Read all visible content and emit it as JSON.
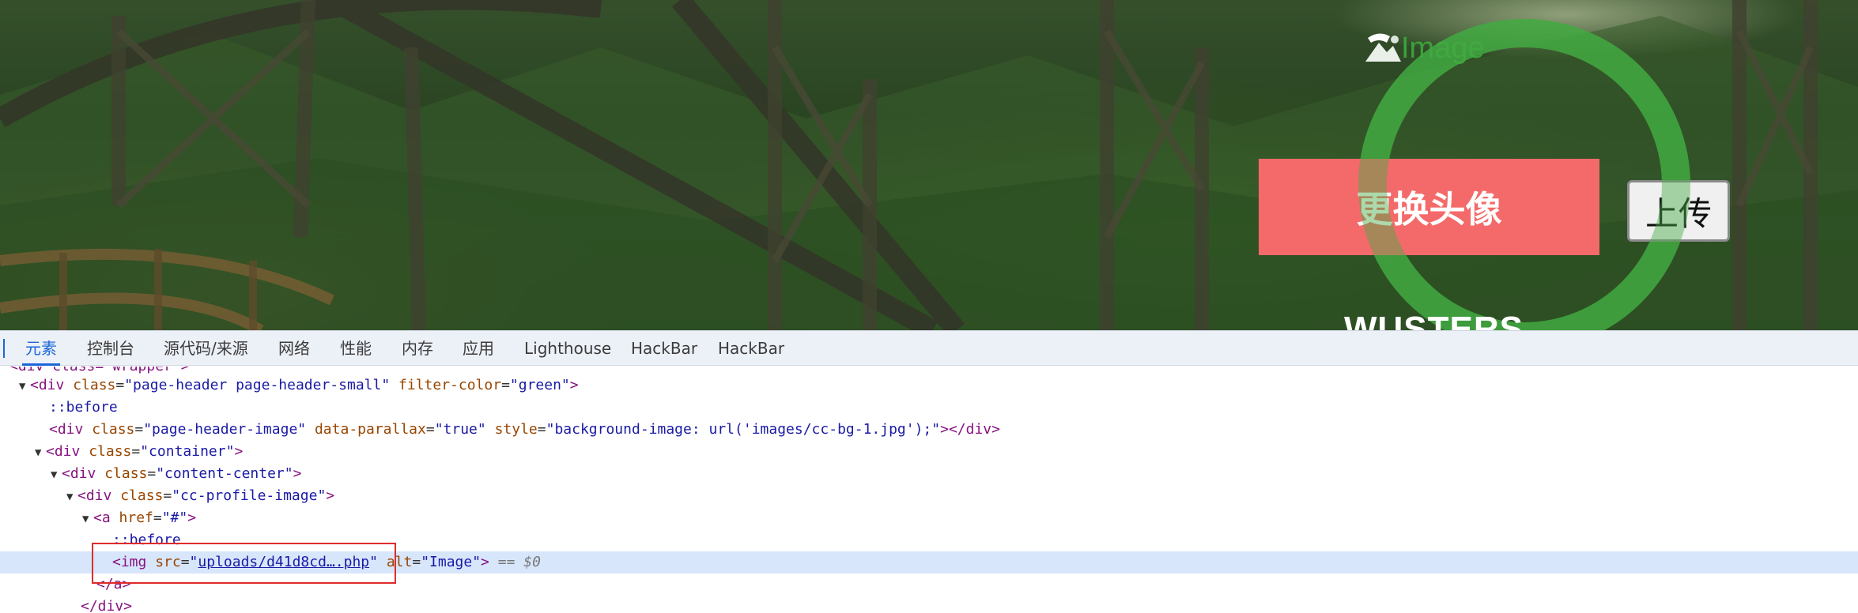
{
  "header": {
    "logo_alt": "Image",
    "change_avatar_label": "更换头像",
    "upload_label": "上传",
    "username": "WUSTERS"
  },
  "colors": {
    "change_button": "#f46a6a",
    "ring": "#3caa3c",
    "devtools_accent": "#1a66d9",
    "selected_row": "#d7e6fb",
    "highlight_box": "#e02b2b"
  },
  "devtools": {
    "tabs": [
      "元素",
      "控制台",
      "源代码/来源",
      "网络",
      "性能",
      "内存",
      "应用",
      "Lighthouse",
      "HackBar",
      "HackBar"
    ],
    "active_tab": "元素",
    "tree": {
      "line0": "<div class=\"wrapper\">",
      "line1": {
        "tag_open": "<div ",
        "a1": "class",
        "v1": "\"page-header page-header-small\"",
        "a2": "filter-color",
        "v2": "\"green\"",
        "tag_close": ">"
      },
      "line2": "::before",
      "line3": {
        "tag_open": "<div ",
        "a1": "class",
        "v1": "\"page-header-image\"",
        "a2": "data-parallax",
        "v2": "\"true\"",
        "a3": "style",
        "v3": "\"background-image: url('images/cc-bg-1.jpg');\"",
        "tag_close": "></div>"
      },
      "line4": {
        "tag_open": "<div ",
        "a1": "class",
        "v1": "\"container\"",
        "tag_close": ">"
      },
      "line5": {
        "tag_open": "<div ",
        "a1": "class",
        "v1": "\"content-center\"",
        "tag_close": ">"
      },
      "line6": {
        "tag_open": "<div ",
        "a1": "class",
        "v1": "\"cc-profile-image\"",
        "tag_close": ">"
      },
      "line7": {
        "tag_open": "<a ",
        "a1": "href",
        "v1": "\"#\"",
        "tag_close": ">"
      },
      "line8": "::before",
      "line9": {
        "tag_open": "<img ",
        "a1": "src",
        "quote": "\"",
        "src_link": "uploads/d41d8cd….php",
        "a2": "alt",
        "v2": "\"Image\"",
        "tag_close": ">",
        "console_ref": "== $0"
      },
      "line10": "</a>",
      "line11": "</div>"
    }
  }
}
